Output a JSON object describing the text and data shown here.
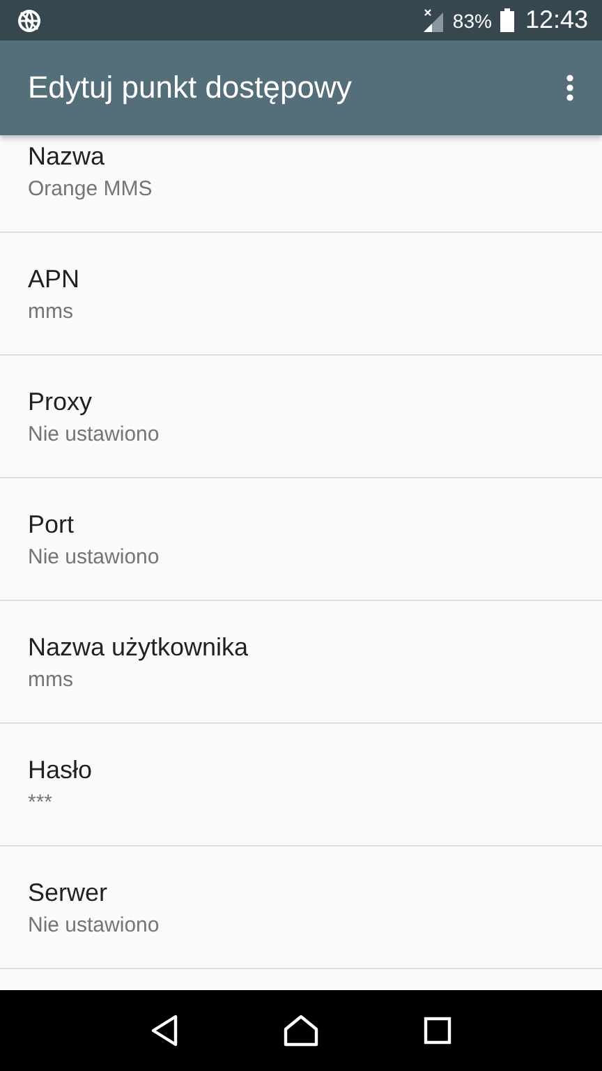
{
  "status_bar": {
    "battery": "83%",
    "time": "12:43"
  },
  "app_bar": {
    "title": "Edytuj punkt dostępowy"
  },
  "settings": [
    {
      "title": "Nazwa",
      "value": "Orange MMS"
    },
    {
      "title": "APN",
      "value": "mms"
    },
    {
      "title": "Proxy",
      "value": "Nie ustawiono"
    },
    {
      "title": "Port",
      "value": "Nie ustawiono"
    },
    {
      "title": "Nazwa użytkownika",
      "value": "mms"
    },
    {
      "title": "Hasło",
      "value": "***"
    },
    {
      "title": "Serwer",
      "value": "Nie ustawiono"
    }
  ]
}
